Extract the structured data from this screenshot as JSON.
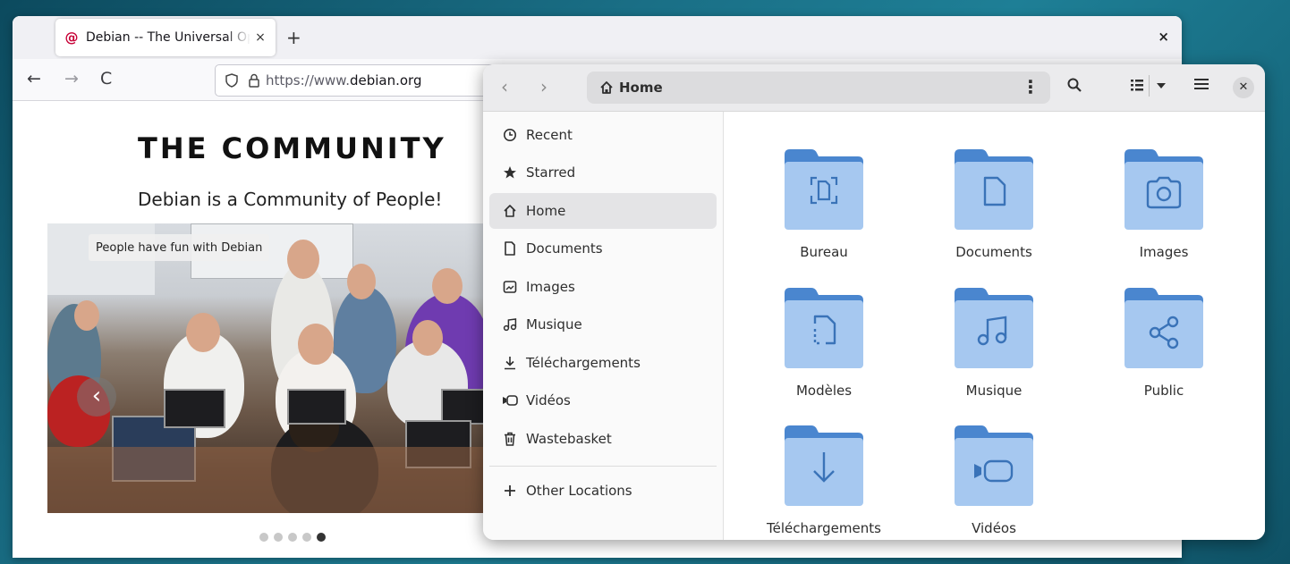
{
  "browser": {
    "tab_title": "Debian -- The Universal Operating System",
    "tab_favicon": "debian-swirl-icon",
    "new_tab": "+",
    "close_window": "×",
    "url_prefix": "https://www.",
    "url_domain": "debian.org",
    "page": {
      "heading": "THE COMMUNITY",
      "subheading": "Debian is a Community of People!",
      "photo_caption": "People have fun with Debian",
      "carousel_prev": "‹"
    }
  },
  "files": {
    "location": "Home",
    "sidebar": [
      {
        "label": "Recent",
        "icon": "clock-icon"
      },
      {
        "label": "Starred",
        "icon": "star-icon"
      },
      {
        "label": "Home",
        "icon": "home-icon"
      },
      {
        "label": "Documents",
        "icon": "document-icon"
      },
      {
        "label": "Images",
        "icon": "image-icon"
      },
      {
        "label": "Musique",
        "icon": "music-icon"
      },
      {
        "label": "Téléchargements",
        "icon": "download-icon"
      },
      {
        "label": "Vidéos",
        "icon": "video-icon"
      },
      {
        "label": "Wastebasket",
        "icon": "trash-icon"
      },
      {
        "label": "Other Locations",
        "icon": "plus-icon"
      }
    ],
    "folders": [
      {
        "label": "Bureau",
        "icon": "desktop-icon"
      },
      {
        "label": "Documents",
        "icon": "document-icon"
      },
      {
        "label": "Images",
        "icon": "camera-icon"
      },
      {
        "label": "Modèles",
        "icon": "template-icon"
      },
      {
        "label": "Musique",
        "icon": "music-icon"
      },
      {
        "label": "Public",
        "icon": "share-icon"
      },
      {
        "label": "Téléchargements",
        "icon": "download-icon"
      },
      {
        "label": "Vidéos",
        "icon": "video-icon"
      }
    ]
  },
  "colors": {
    "folder_top": "#4a86cf",
    "folder_body": "#a6c8f0",
    "debian_red": "#c70036"
  }
}
